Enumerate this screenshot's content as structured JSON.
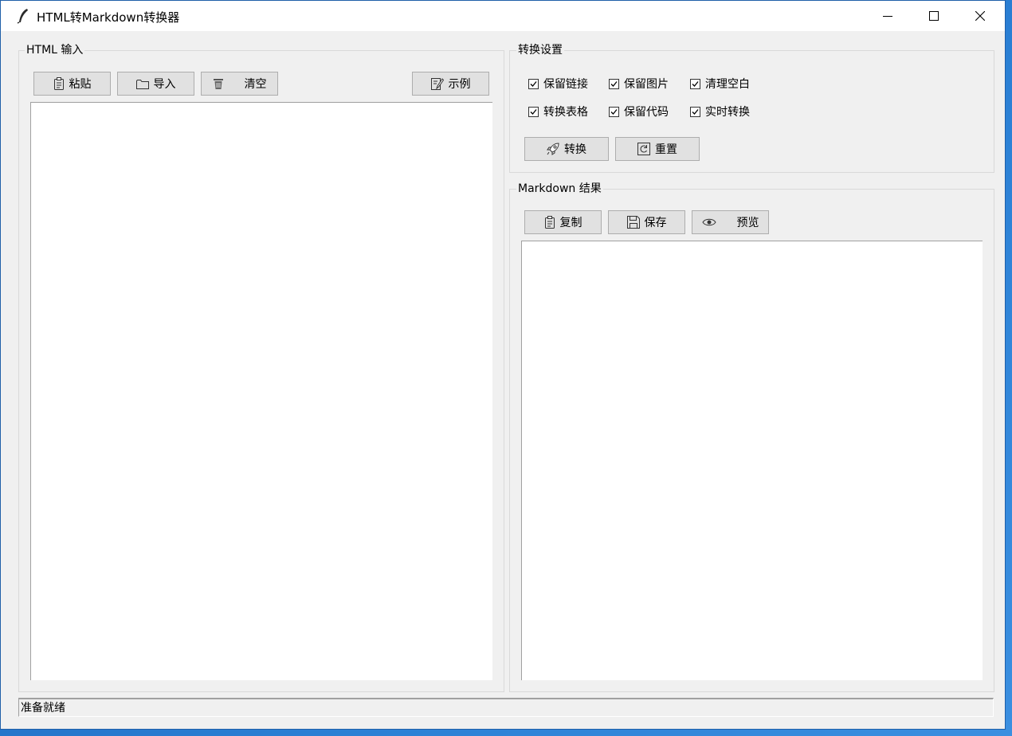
{
  "window": {
    "title": "HTML转Markdown转换器",
    "icon": "feather-icon",
    "controls": [
      "minimize-icon",
      "maximize-icon",
      "close-icon"
    ]
  },
  "input_panel": {
    "label": "HTML 输入",
    "buttons": {
      "paste": {
        "label": "粘贴",
        "icon": "clipboard-icon"
      },
      "import": {
        "label": "导入",
        "icon": "folder-icon"
      },
      "clear": {
        "label": "清空",
        "icon": "trash-icon"
      },
      "example": {
        "label": "示例",
        "icon": "edit-note-icon"
      }
    },
    "content": ""
  },
  "settings_panel": {
    "label": "转换设置",
    "options": [
      {
        "label": "保留链接",
        "checked": true
      },
      {
        "label": "保留图片",
        "checked": true
      },
      {
        "label": "清理空白",
        "checked": true
      },
      {
        "label": "转换表格",
        "checked": true
      },
      {
        "label": "保留代码",
        "checked": true
      },
      {
        "label": "实时转换",
        "checked": true
      }
    ],
    "buttons": {
      "convert": {
        "label": "转换",
        "icon": "rocket-icon"
      },
      "reset": {
        "label": "重置",
        "icon": "refresh-icon"
      }
    }
  },
  "output_panel": {
    "label": "Markdown 结果",
    "buttons": {
      "copy": {
        "label": "复制",
        "icon": "clipboard-icon"
      },
      "save": {
        "label": "保存",
        "icon": "floppy-disk-icon"
      },
      "preview": {
        "label": "预览",
        "icon": "eye-icon"
      }
    },
    "content": ""
  },
  "status": {
    "text": "准备就绪"
  }
}
